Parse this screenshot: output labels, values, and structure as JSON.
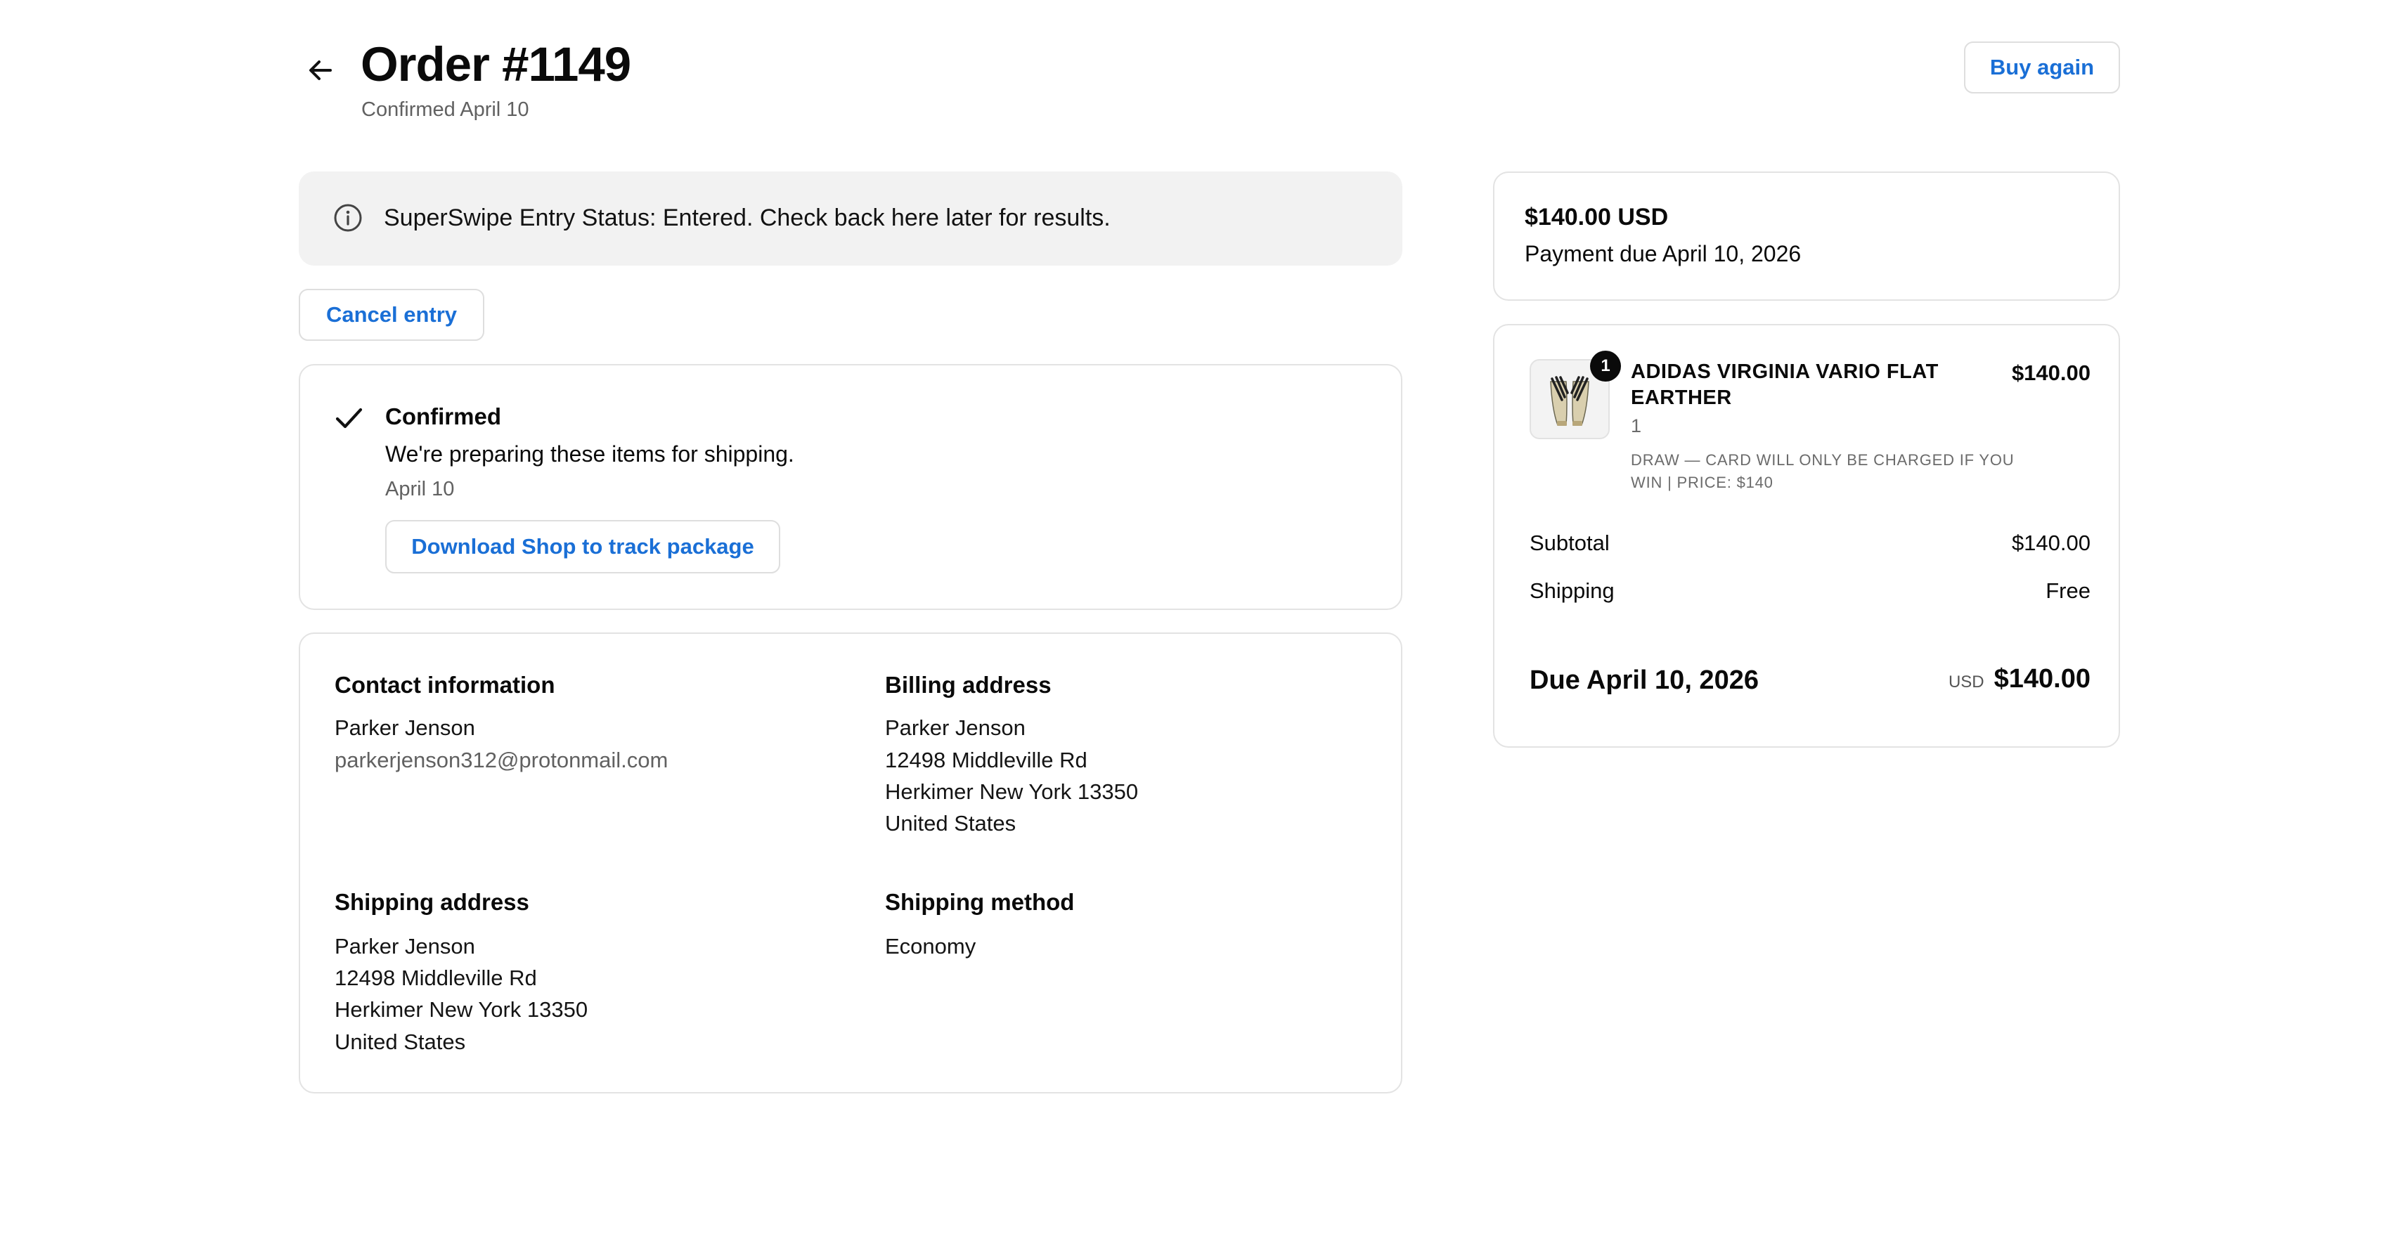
{
  "header": {
    "title": "Order #1149",
    "subtitle": "Confirmed April 10",
    "buy_again_label": "Buy again"
  },
  "banner": {
    "text": "SuperSwipe Entry Status: Entered. Check back here later for results."
  },
  "cancel_entry_label": "Cancel entry",
  "status": {
    "heading": "Confirmed",
    "description": "We're preparing these items for shipping.",
    "date": "April 10",
    "download_label": "Download Shop to track package"
  },
  "contact": {
    "heading": "Contact information",
    "name": "Parker Jenson",
    "email": "parkerjenson312@protonmail.com"
  },
  "billing": {
    "heading": "Billing address",
    "lines": [
      "Parker Jenson",
      "12498 Middleville Rd",
      "Herkimer New York 13350",
      "United States"
    ]
  },
  "shipping_address": {
    "heading": "Shipping address",
    "lines": [
      "Parker Jenson",
      "12498 Middleville Rd",
      "Herkimer New York 13350",
      "United States"
    ]
  },
  "shipping_method": {
    "heading": "Shipping method",
    "value": "Economy"
  },
  "payment": {
    "amount": "$140.00 USD",
    "due": "Payment due April 10, 2026"
  },
  "item": {
    "badge": "1",
    "name": "ADIDAS VIRGINIA VARIO FLAT EARTHER",
    "price": "$140.00",
    "quantity": "1",
    "note": "DRAW — CARD WILL ONLY BE CHARGED IF YOU WIN | PRICE: $140"
  },
  "totals": {
    "subtotal_label": "Subtotal",
    "subtotal_value": "$140.00",
    "shipping_label": "Shipping",
    "shipping_value": "Free",
    "due_label": "Due April 10, 2026",
    "currency": "USD",
    "due_value": "$140.00"
  },
  "colors": {
    "link": "#1a6fd6",
    "banner_bg": "#f2f2f2",
    "border": "#e3e3e3"
  }
}
